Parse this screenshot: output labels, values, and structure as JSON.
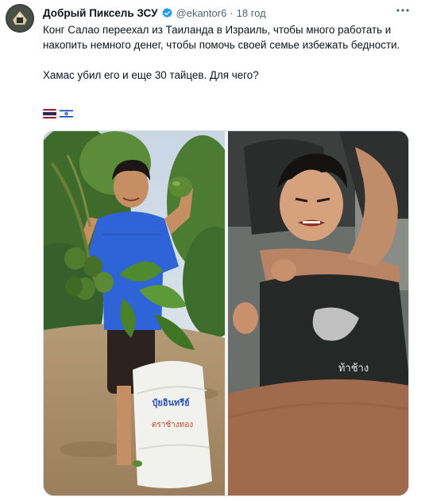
{
  "author": {
    "display_name": "Добрый Пиксель ЗСУ",
    "handle": "@ekantor6",
    "separator": "·",
    "time": "18 год"
  },
  "tweet": {
    "text": "Конг Салао переехал из Таиланда в Израиль, чтобы много работать и накопить немного денег, чтобы помочь своей семье избежать бедности.\n\nХамас убил его и еще 30 тайцев. Для чего?",
    "flags": [
      "thailand-flag",
      "israel-flag"
    ],
    "sack_text_top": "ปุ๋ยอินทรีย์",
    "sack_text_bottom": "ตราช้างทอง"
  },
  "colors": {
    "verified": "#1d9bf0",
    "muted_text": "#536471",
    "border": "#cfd9de"
  }
}
